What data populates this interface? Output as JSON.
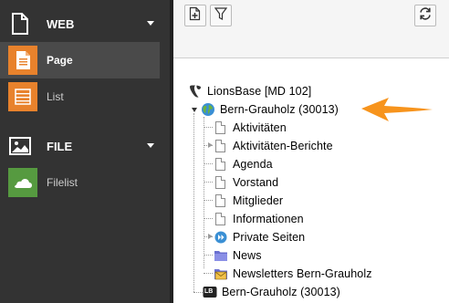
{
  "sidebar": {
    "groups": [
      {
        "label": "WEB",
        "icon": "file-icon",
        "items": [
          {
            "label": "Page",
            "icon": "page-module-icon",
            "active": true,
            "color": "#e8822c"
          },
          {
            "label": "List",
            "icon": "list-module-icon",
            "active": false,
            "color": "#e8822c"
          }
        ]
      },
      {
        "label": "FILE",
        "icon": "image-icon",
        "items": [
          {
            "label": "Filelist",
            "icon": "filelist-module-icon",
            "active": false,
            "color": "#569a40"
          }
        ]
      }
    ]
  },
  "toolbar": {
    "buttons": [
      {
        "name": "new-page-button",
        "icon": "new-page-icon"
      },
      {
        "name": "filter-button",
        "icon": "filter-icon"
      },
      {
        "name": "refresh-button",
        "icon": "refresh-icon"
      }
    ]
  },
  "tree": {
    "root": {
      "label": "LionsBase [MD 102]",
      "icon": "typo3-icon"
    },
    "site": {
      "label": "Bern-Grauholz (30013)",
      "icon": "globe-icon"
    },
    "children": [
      {
        "label": "Aktivitäten",
        "icon": "page-icon",
        "expandable": false
      },
      {
        "label": "Aktivitäten-Berichte",
        "icon": "page-icon",
        "expandable": true
      },
      {
        "label": "Agenda",
        "icon": "page-icon",
        "expandable": false
      },
      {
        "label": "Vorstand",
        "icon": "page-icon",
        "expandable": false
      },
      {
        "label": "Mitglieder",
        "icon": "page-icon",
        "expandable": false
      },
      {
        "label": "Informationen",
        "icon": "page-icon",
        "expandable": false
      },
      {
        "label": "Private Seiten",
        "icon": "private-pages-icon",
        "expandable": true
      },
      {
        "label": "News",
        "icon": "folder-icon",
        "expandable": false
      },
      {
        "label": "Newsletters Bern-Grauholz",
        "icon": "newsletter-icon",
        "expandable": false
      }
    ],
    "last": {
      "label": "Bern-Grauholz (30013)",
      "icon": "lb-icon",
      "badge": "LB"
    }
  },
  "colors": {
    "sidebar_bg": "#333333",
    "accent_orange": "#f7941d",
    "page_module": "#e8822c",
    "file_module": "#569a40"
  }
}
